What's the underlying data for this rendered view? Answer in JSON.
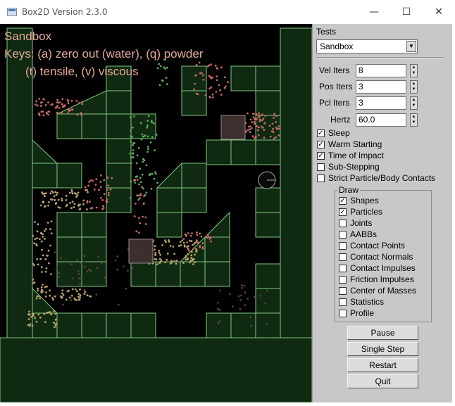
{
  "window": {
    "title": "Box2D Version 2.3.0",
    "minimize_glyph": "—",
    "maximize_glyph": "☐",
    "close_glyph": "✕"
  },
  "viewport": {
    "overlay_lines": [
      "Sandbox",
      "Keys: (a) zero out (water), (q) powder",
      "(t) tensile, (v) viscous"
    ],
    "colors": {
      "background": "#000000",
      "wall_fill": "#0f2a10",
      "wall_edge": "#84c884",
      "static_box": "#3e2f2f",
      "particle_red": "#c86864",
      "particle_green": "#5cae5c",
      "particle_tan": "#b9a06e"
    }
  },
  "panel": {
    "tests_label": "Tests",
    "tests_selected": "Sandbox",
    "fields": [
      {
        "label": "Vel Iters",
        "value": "8"
      },
      {
        "label": "Pos Iters",
        "value": "3"
      },
      {
        "label": "Pcl Iters",
        "value": "3"
      },
      {
        "label": "Hertz",
        "value": "60.0"
      }
    ],
    "options": [
      {
        "label": "Sleep",
        "checked": true
      },
      {
        "label": "Warm Starting",
        "checked": true
      },
      {
        "label": "Time of Impact",
        "checked": true
      },
      {
        "label": "Sub-Stepping",
        "checked": false
      },
      {
        "label": "Strict Particle/Body Contacts",
        "checked": false
      }
    ],
    "draw_label": "Draw",
    "draw_options": [
      {
        "label": "Shapes",
        "checked": true
      },
      {
        "label": "Particles",
        "checked": true
      },
      {
        "label": "Joints",
        "checked": false
      },
      {
        "label": "AABBs",
        "checked": false
      },
      {
        "label": "Contact Points",
        "checked": false
      },
      {
        "label": "Contact Normals",
        "checked": false
      },
      {
        "label": "Contact Impulses",
        "checked": false
      },
      {
        "label": "Friction Impulses",
        "checked": false
      },
      {
        "label": "Center of Masses",
        "checked": false
      },
      {
        "label": "Statistics",
        "checked": false
      },
      {
        "label": "Profile",
        "checked": false
      }
    ],
    "buttons": [
      "Pause",
      "Single Step",
      "Restart",
      "Quit"
    ]
  }
}
